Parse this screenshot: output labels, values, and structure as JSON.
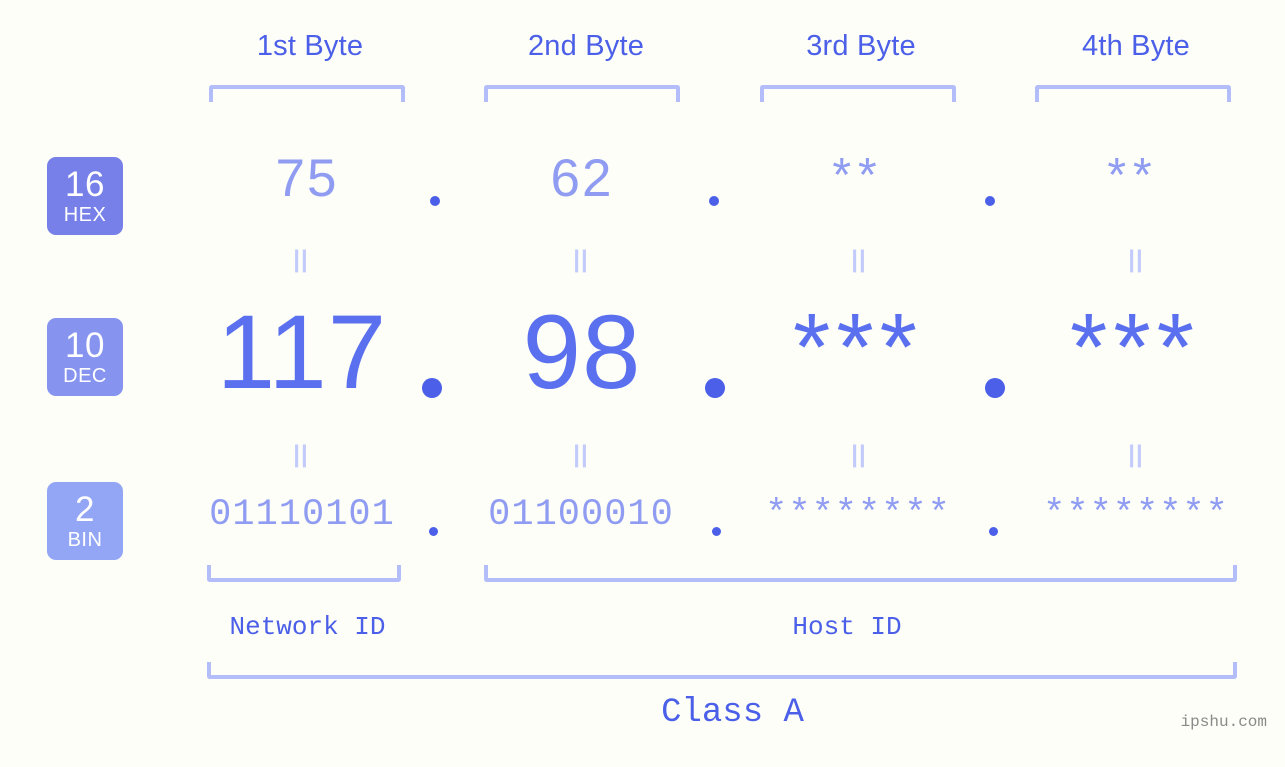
{
  "background_color": "#fcfef7",
  "accent_color": "#4b5fe8",
  "muted_color": "#8f9cf2",
  "bracket_color": "#b3bdfa",
  "headers": [
    {
      "label": "1st Byte"
    },
    {
      "label": "2nd Byte"
    },
    {
      "label": "3rd Byte"
    },
    {
      "label": "4th Byte"
    }
  ],
  "radix_badges": [
    {
      "number": "16",
      "abbr": "HEX",
      "color": "#7680e8"
    },
    {
      "number": "10",
      "abbr": "DEC",
      "color": "#8693ef"
    },
    {
      "number": "2",
      "abbr": "BIN",
      "color": "#93a6f5"
    }
  ],
  "rows": {
    "hex": {
      "values": [
        "75",
        "62",
        "**",
        "**"
      ]
    },
    "dec": {
      "values": [
        "117",
        "98",
        "***",
        "***"
      ]
    },
    "bin": {
      "values": [
        "01110101",
        "01100010",
        "********",
        "********"
      ]
    }
  },
  "separators": {
    "dot": ".",
    "equals": "||"
  },
  "sections": {
    "network_id": "Network ID",
    "host_id": "Host ID",
    "class": "Class A"
  },
  "watermark": "ipshu.com"
}
